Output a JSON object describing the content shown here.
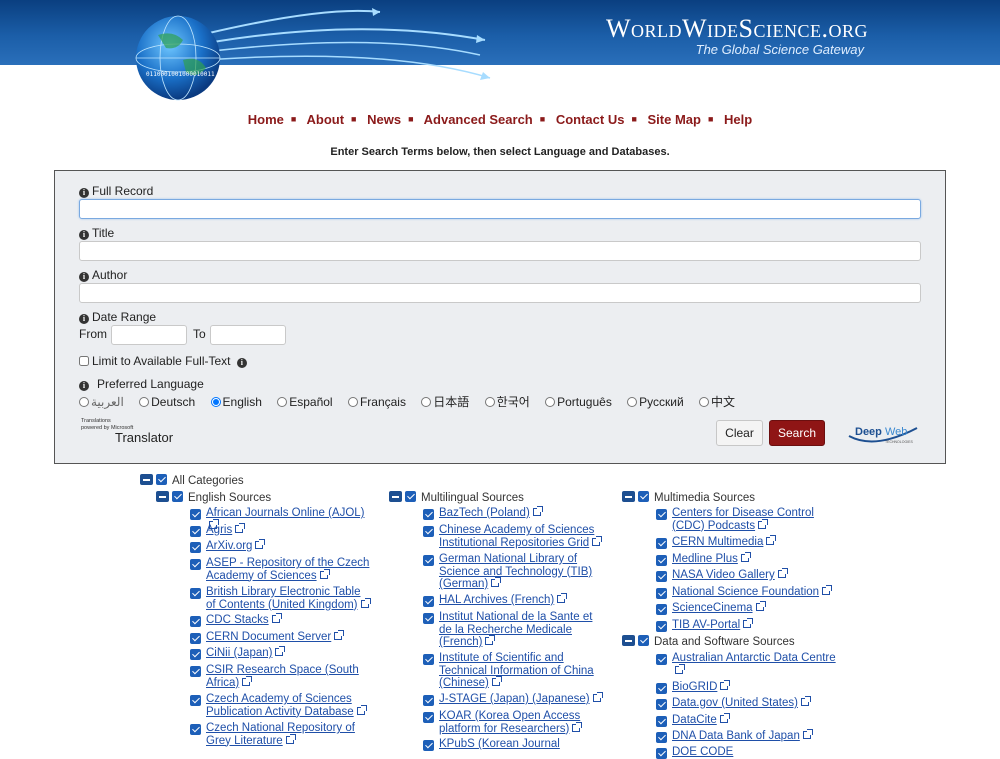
{
  "header": {
    "site_title": "WorldWideScience.org",
    "tagline": "The Global Science Gateway",
    "globe_text": "0110001001000010011"
  },
  "nav": {
    "items": [
      "Home",
      "About",
      "News",
      "Advanced Search",
      "Contact Us",
      "Site Map",
      "Help"
    ]
  },
  "instructions": "Enter Search Terms below, then select Language and Databases.",
  "search": {
    "full_record_label": "Full Record",
    "full_record_value": "",
    "title_label": "Title",
    "title_value": "",
    "author_label": "Author",
    "author_value": "",
    "date_range_label": "Date Range",
    "from_label": "From",
    "from_value": "",
    "to_label": "To",
    "to_value": "",
    "limit_label": "Limit to Available Full-Text",
    "limit_checked": false,
    "pref_lang_label": "Preferred Language",
    "languages": [
      "العربية",
      "Deutsch",
      "English",
      "Español",
      "Français",
      "日本語",
      "한국어",
      "Português",
      "Русский",
      "中文"
    ],
    "selected_language": "English",
    "translator_small_1": "Translations",
    "translator_small_2": "powered by Microsoft",
    "translator_big": "Translator",
    "clear_label": "Clear",
    "search_label": "Search",
    "deepweb_logo_1": "Deep",
    "deepweb_logo_2": "Web",
    "deepweb_logo_3": "TECHNOLOGIES"
  },
  "categories": {
    "all_label": "All Categories",
    "english": {
      "label": "English Sources",
      "items": [
        "African Journals Online (AJOL)",
        "Agris",
        "ArXiv.org",
        "ASEP - Repository of the Czech Academy of Sciences",
        "British Library Electronic Table of Contents (United Kingdom)",
        "CDC Stacks",
        "CERN Document Server",
        "CiNii (Japan)",
        "CSIR Research Space (South Africa)",
        "Czech Academy of Sciences Publication Activity Database",
        "Czech National Repository of Grey Literature"
      ]
    },
    "multilingual": {
      "label": "Multilingual Sources",
      "items": [
        "BazTech (Poland)",
        "Chinese Academy of Sciences Institutional Repositories Grid",
        "German National Library of Science and Technology (TIB) (German)",
        "HAL Archives (French)",
        "Institut National de la Sante et de la Recherche Medicale (French)",
        "Institute of Scientific and Technical Information of China (Chinese)",
        "J-STAGE (Japan) (Japanese)",
        "KOAR (Korea Open Access platform for Researchers)",
        "KPubS (Korean Journal"
      ]
    },
    "multimedia": {
      "label": "Multimedia Sources",
      "items": [
        "Centers for Disease Control (CDC) Podcasts",
        "CERN Multimedia",
        "Medline Plus",
        "NASA Video Gallery",
        "National Science Foundation",
        "ScienceCinema",
        "TIB AV-Portal"
      ]
    },
    "data_software": {
      "label": "Data and Software Sources",
      "items": [
        "Australian Antarctic Data Centre",
        "BioGRID",
        "Data.gov (United States)",
        "DataCite",
        "DNA Data Bank of Japan",
        "DOE CODE"
      ]
    }
  },
  "colors": {
    "banner": "#0a3f80",
    "nav_link": "#8b1a1a",
    "search_button": "#8f1515",
    "link": "#1f4fa8",
    "checkbox": "#1d5fb8"
  }
}
